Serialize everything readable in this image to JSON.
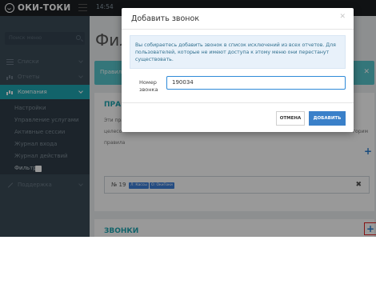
{
  "app": {
    "logo_text": "ОКИ-ТОКИ",
    "clock": "14:54"
  },
  "sidebar": {
    "search_placeholder": "Поиск меню",
    "items": [
      {
        "label": "Списки",
        "icon": "list-icon"
      },
      {
        "label": "Отчеты",
        "icon": "bar-chart-icon"
      },
      {
        "label": "Компания",
        "icon": "bar-chart-icon",
        "active": true
      },
      {
        "label": "Поддержка",
        "icon": "wrench-icon"
      }
    ],
    "submenu": [
      {
        "label": "Настройки"
      },
      {
        "label": "Управление услугами"
      },
      {
        "label": "Активные сессии"
      },
      {
        "label": "Журнал входа"
      },
      {
        "label": "Журнал действий"
      },
      {
        "label": "Фильтр",
        "current": true
      }
    ]
  },
  "main": {
    "title": "Фил",
    "alert_text": "Правил",
    "rules": {
      "title": "ПРАВ",
      "desc_line1": "Эти пра",
      "desc_line1_right": "",
      "desc_line2_left": "целесо",
      "desc_line2_right": "горим",
      "desc_line3": "правила"
    },
    "rule": {
      "number": "№ 19",
      "tags": [
        "Л: Кассы",
        "О: ОкиТоки"
      ]
    },
    "calls": {
      "title": "ЗВОНКИ"
    }
  },
  "modal": {
    "title": "Добавить звонок",
    "info": "Вы собираетесь добавить звонок в список исключений из всех отчетов. Для пользователей, которые не имеют доступа к этому меню они перестанут существовать.",
    "field_label": "Номер звонка",
    "field_value": "190034",
    "cancel_label": "ОТМЕНА",
    "submit_label": "ДОБАВИТЬ"
  },
  "colors": {
    "accent": "#1fa6b1",
    "primary": "#3a80c9",
    "highlight": "#e02020"
  }
}
